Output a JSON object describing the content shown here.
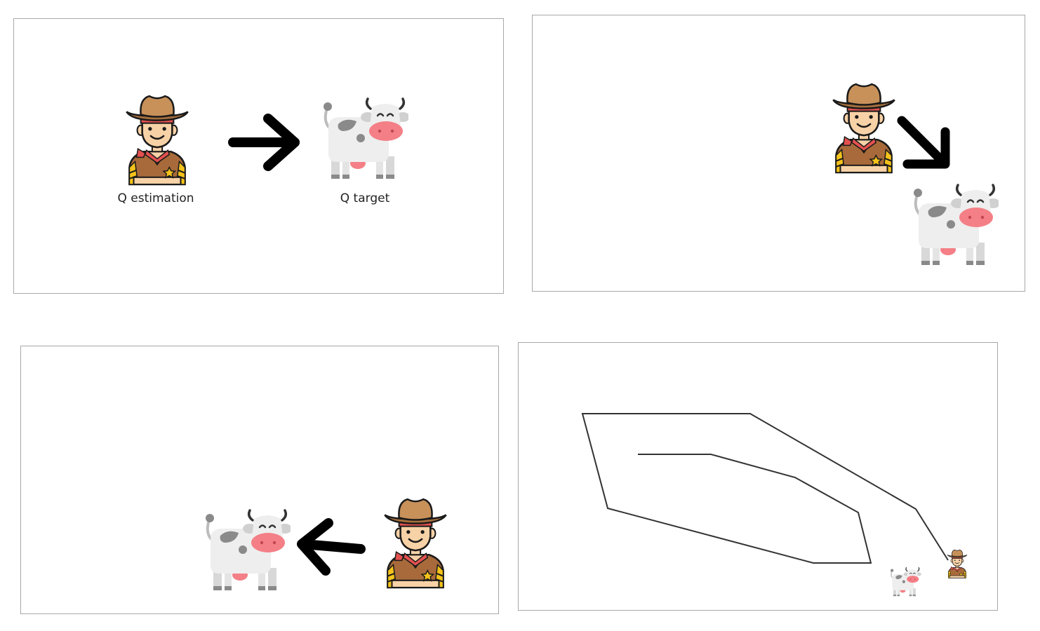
{
  "panels": [
    {
      "id": "panel-1",
      "labels": {
        "q_estimation": "Q estimation",
        "q_target": "Q target"
      },
      "icons": [
        "cowboy-icon",
        "right-arrow-icon",
        "cow-icon"
      ]
    },
    {
      "id": "panel-2",
      "icons": [
        "cowboy-icon",
        "down-right-arrow-icon",
        "cow-icon"
      ]
    },
    {
      "id": "panel-3",
      "icons": [
        "cow-icon",
        "left-arrow-icon",
        "cowboy-icon"
      ]
    },
    {
      "id": "panel-4",
      "icons": [
        "path-line",
        "cow-icon",
        "cowboy-icon"
      ]
    }
  ],
  "colors": {
    "hat": "#c8915a",
    "hat_dark": "#a66f3c",
    "hat_band": "#e4514f",
    "skin": "#f7d2a6",
    "vest": "#a86a3a",
    "bandana": "#e4514f",
    "stripes": "#f4c21b",
    "cow_body": "#eeeeee",
    "cow_spot": "#8a8a8a",
    "cow_snout": "#f47f86",
    "arrow": "#000000",
    "line": "#333333",
    "outline": "#1a1a1a"
  }
}
